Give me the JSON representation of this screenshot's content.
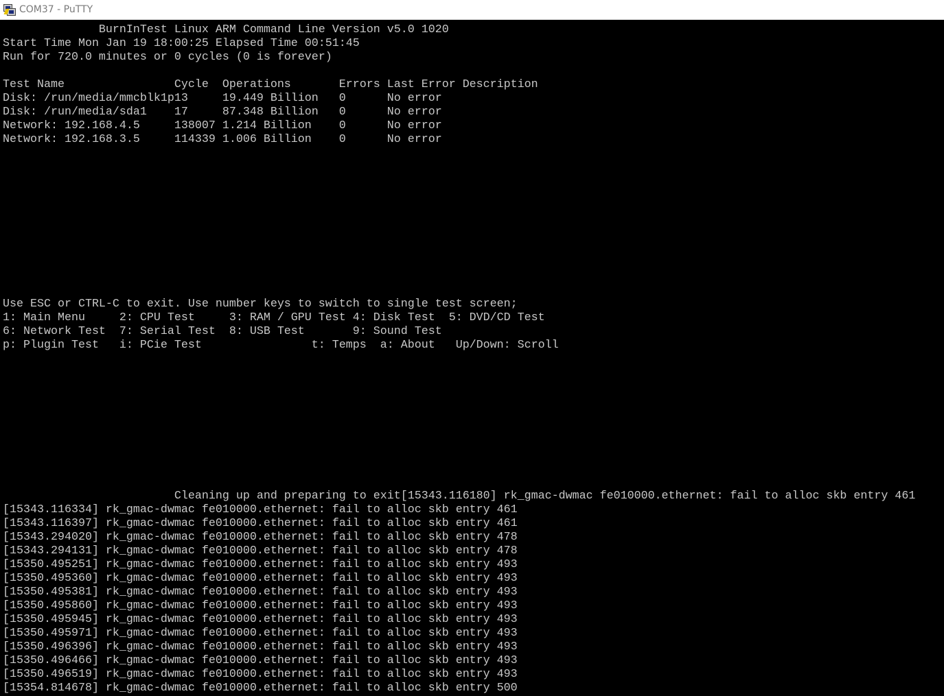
{
  "window": {
    "title": "COM37 - PuTTY"
  },
  "terminal": {
    "lines": [
      "              BurnInTest Linux ARM Command Line Version v5.0 1020",
      "Start Time Mon Jan 19 18:00:25 Elapsed Time 00:51:45",
      "Run for 720.0 minutes or 0 cycles (0 is forever)",
      "",
      "Test Name                Cycle  Operations       Errors Last Error Description",
      "Disk: /run/media/mmcblk1p13     19.449 Billion   0      No error",
      "Disk: /run/media/sda1    17     87.348 Billion   0      No error",
      "Network: 192.168.4.5     138007 1.214 Billion    0      No error",
      "Network: 192.168.3.5     114339 1.006 Billion    0      No error",
      "",
      "",
      "",
      "",
      "",
      "",
      "",
      "",
      "",
      "",
      "",
      "Use ESC or CTRL-C to exit. Use number keys to switch to single test screen;",
      "1: Main Menu     2: CPU Test     3: RAM / GPU Test 4: Disk Test  5: DVD/CD Test",
      "6: Network Test  7: Serial Test  8: USB Test       9: Sound Test",
      "p: Plugin Test   i: PCie Test                t: Temps  a: About   Up/Down: Scroll",
      "",
      "",
      "",
      "",
      "",
      "",
      "",
      "",
      "",
      "",
      "                         Cleaning up and preparing to exit[15343.116180] rk_gmac-dwmac fe010000.ethernet: fail to alloc skb entry 461",
      "[15343.116334] rk_gmac-dwmac fe010000.ethernet: fail to alloc skb entry 461",
      "[15343.116397] rk_gmac-dwmac fe010000.ethernet: fail to alloc skb entry 461",
      "[15343.294020] rk_gmac-dwmac fe010000.ethernet: fail to alloc skb entry 478",
      "[15343.294131] rk_gmac-dwmac fe010000.ethernet: fail to alloc skb entry 478",
      "[15350.495251] rk_gmac-dwmac fe010000.ethernet: fail to alloc skb entry 493",
      "[15350.495360] rk_gmac-dwmac fe010000.ethernet: fail to alloc skb entry 493",
      "[15350.495381] rk_gmac-dwmac fe010000.ethernet: fail to alloc skb entry 493",
      "[15350.495860] rk_gmac-dwmac fe010000.ethernet: fail to alloc skb entry 493",
      "[15350.495945] rk_gmac-dwmac fe010000.ethernet: fail to alloc skb entry 493",
      "[15350.495971] rk_gmac-dwmac fe010000.ethernet: fail to alloc skb entry 493",
      "[15350.496396] rk_gmac-dwmac fe010000.ethernet: fail to alloc skb entry 493",
      "[15350.496466] rk_gmac-dwmac fe010000.ethernet: fail to alloc skb entry 493",
      "[15350.496519] rk_gmac-dwmac fe010000.ethernet: fail to alloc skb entry 493",
      "[15354.814678] rk_gmac-dwmac fe010000.ethernet: fail to alloc skb entry 500"
    ]
  },
  "colors": {
    "background": "#000000",
    "foreground": "#c8c8c8",
    "titlebar": "#ffffff",
    "title_text": "#7a7a7a"
  },
  "icons": {
    "app": "putty-icon"
  }
}
